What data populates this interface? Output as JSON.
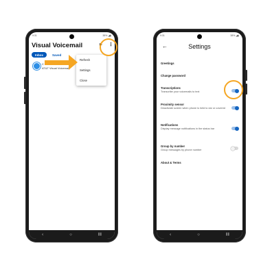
{
  "left_phone": {
    "status": {
      "time": "9:31",
      "icons": "38% ◢▮"
    },
    "title": "Visual Voicemail",
    "tabs": [
      {
        "label": "Inbox"
      },
      {
        "label": "Saved"
      }
    ],
    "voicemail": {
      "name": "C",
      "subtitle": "AT&T Visual Voicemail"
    },
    "menu": [
      {
        "label": "Refresh"
      },
      {
        "label": "Settings"
      },
      {
        "label": "Close"
      }
    ],
    "more_icon_glyph": "⋮",
    "nav": {
      "back": "‹",
      "home": "○",
      "recents": "‖‖"
    }
  },
  "right_phone": {
    "status": {
      "time": "9:31",
      "icons": "38% ◢▮"
    },
    "back_glyph": "←",
    "title": "Settings",
    "settings": [
      {
        "label": "Greetings",
        "sub": ""
      },
      {
        "label": "Change password",
        "sub": ""
      },
      {
        "label": "Transcriptions",
        "sub": "Transcribe your voicemails to text",
        "toggle": "on"
      },
      {
        "label": "Proximity sensor",
        "sub": "Deactivate screen when phone is held to ear or covered",
        "toggle": "on"
      },
      {
        "label": "Notifications",
        "sub": "Display message notifications in the status bar",
        "toggle": "on"
      },
      {
        "label": "Group by number",
        "sub": "Group messages by phone number",
        "toggle": "off"
      },
      {
        "label": "About & Terms",
        "sub": ""
      }
    ],
    "nav": {
      "back": "‹",
      "home": "○",
      "recents": "‖‖"
    }
  },
  "colors": {
    "accent": "#f5a623",
    "brand_blue": "#0057b8",
    "toggle_on": "#1565c0",
    "phone_body": "#1b1b1b"
  }
}
